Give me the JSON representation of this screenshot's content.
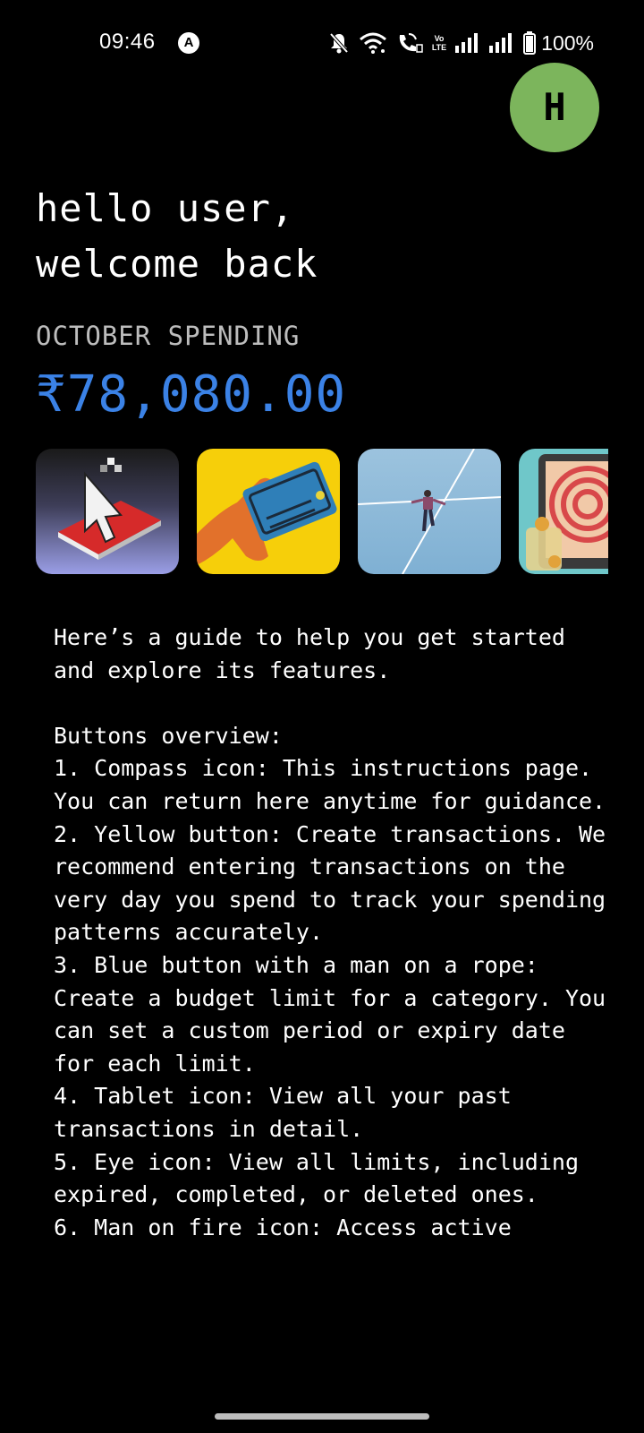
{
  "status_bar": {
    "time": "09:46",
    "app_icon": "A",
    "volte": "Vo LTE",
    "battery": "100%",
    "icons": [
      "notifications-muted-icon",
      "wifi-icon",
      "wifi-calling-icon",
      "volte-icon",
      "signal-icon",
      "signal-icon",
      "battery-icon"
    ]
  },
  "avatar": {
    "initial": "H",
    "color": "#7cb55c"
  },
  "greeting": {
    "line1": "hello user,",
    "line2": "welcome back"
  },
  "spending": {
    "label": "OCTOBER SPENDING",
    "amount": "₹78,080.00",
    "amount_color": "#3b82e6"
  },
  "cards": [
    {
      "name": "instructions-card",
      "icon": "pointer-on-book-icon"
    },
    {
      "name": "create-transaction-card",
      "icon": "card-trap-icon",
      "color": "#f6cf0a"
    },
    {
      "name": "budget-limit-card",
      "icon": "man-on-rope-icon",
      "color": "#8fb9d8"
    },
    {
      "name": "transactions-history-card",
      "icon": "tablet-icon",
      "color": "#6fc7c9"
    }
  ],
  "guide": {
    "intro": "Here’s a guide to help you get started and explore its features.",
    "heading": "Buttons overview:",
    "items": [
      "1. Compass icon: This instructions page. You can return here anytime for guidance.",
      "2. Yellow button: Create transactions. We recommend entering transactions on the very day you spend to track your spending patterns accurately.",
      "3. Blue button with a man on a rope: Create a budget limit for a category. You can set a custom period or expiry date for each limit.",
      "4. Tablet icon: View all your past transactions in detail.",
      "5. Eye icon: View all limits, including expired, completed, or deleted ones.",
      "6. Man on fire icon: Access active"
    ]
  }
}
